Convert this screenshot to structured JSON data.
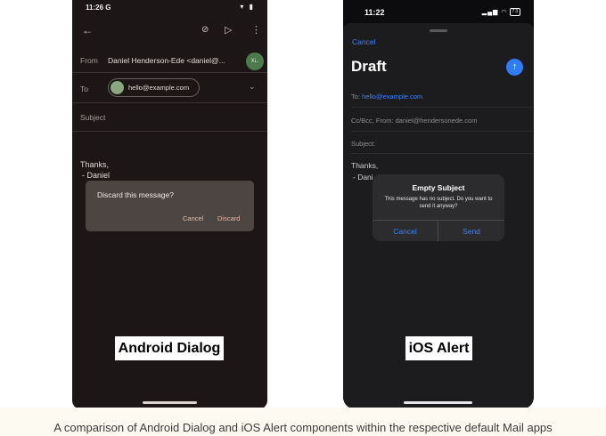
{
  "android": {
    "status_time": "11:26",
    "status_g": "G",
    "from_label": "From",
    "from_value": "Daniel Henderson-Ede <daniel@...",
    "avatar_initials": "Xi..",
    "to_label": "To",
    "to_chip": "hello@example.com",
    "subject_label": "Subject",
    "body_line1": "Thanks,",
    "body_line2": "- Daniel",
    "dialog_title": "Discard this message?",
    "dialog_cancel": "Cancel",
    "dialog_discard": "Discard",
    "badge": "Android Dialog",
    "icons": [
      "back-arrow-icon",
      "attachment-icon",
      "send-icon",
      "more-vert-icon",
      "chevron-down-icon"
    ]
  },
  "ios": {
    "status_time": "11:22",
    "battery": "73",
    "cancel": "Cancel",
    "title": "Draft",
    "to_label": "To:",
    "to_value": "hello@example.com",
    "ccbcc_label": "Cc/Bcc, From:",
    "ccbcc_value": "daniel@hendersonede.com",
    "subject_label": "Subject:",
    "body_line1": "Thanks,",
    "body_line2": "- Dani",
    "alert_title": "Empty Subject",
    "alert_message": "This message has no subject. Do you want to send it anyway?",
    "alert_cancel": "Cancel",
    "alert_send": "Send",
    "badge": "iOS Alert",
    "icons": [
      "send-arrow-up-icon",
      "signal-icon",
      "wifi-icon",
      "battery-icon"
    ]
  },
  "caption": "A comparison of Android Dialog and iOS Alert components within the respective default Mail apps"
}
